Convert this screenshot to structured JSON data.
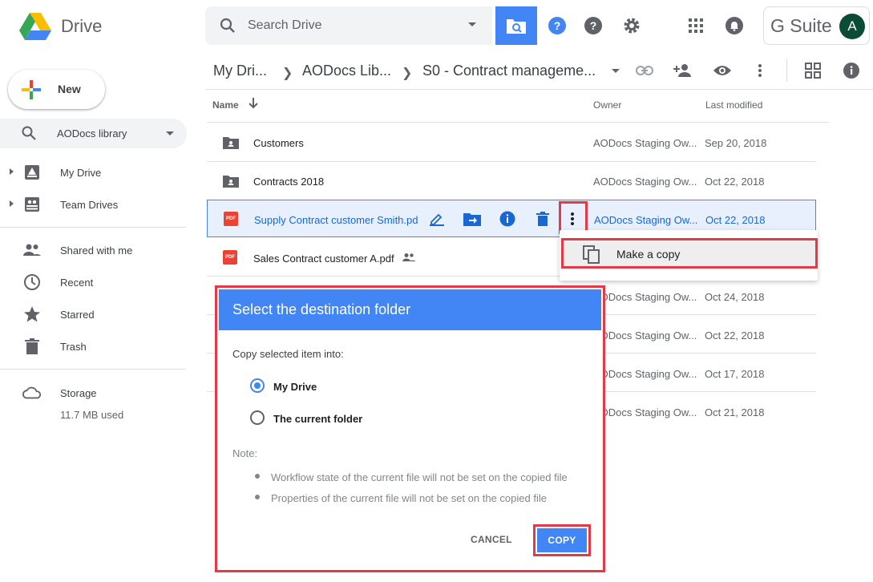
{
  "app": {
    "title": "Drive"
  },
  "search": {
    "placeholder": "Search Drive"
  },
  "header": {
    "suite_label": "G Suite",
    "avatar_letter": "A"
  },
  "sidebar": {
    "new_label": "New",
    "library_label": "AODocs library",
    "items": [
      {
        "label": "My Drive",
        "icon": "my-drive-icon"
      },
      {
        "label": "Team Drives",
        "icon": "team-drives-icon"
      },
      {
        "label": "Shared with me",
        "icon": "people-icon"
      },
      {
        "label": "Recent",
        "icon": "clock-icon"
      },
      {
        "label": "Starred",
        "icon": "star-icon"
      },
      {
        "label": "Trash",
        "icon": "trash-icon"
      },
      {
        "label": "Storage",
        "icon": "cloud-icon"
      }
    ],
    "storage_used": "11.7 MB used"
  },
  "breadcrumb": {
    "items": [
      "My Dri...",
      "AODocs Lib...",
      "S0 - Contract manageme..."
    ]
  },
  "list": {
    "columns": {
      "name": "Name",
      "owner": "Owner",
      "modified": "Last modified"
    },
    "rows": [
      {
        "name": "Customers",
        "owner": "AODocs Staging Ow...",
        "modified": "Sep 20, 2018",
        "type": "shared-folder"
      },
      {
        "name": "Contracts 2018",
        "owner": "AODocs Staging Ow...",
        "modified": "Oct 22, 2018",
        "type": "shared-folder"
      },
      {
        "name": "Supply Contract customer Smith.pd",
        "owner": "AODocs Staging Ow...",
        "modified": "Oct 22, 2018",
        "type": "pdf",
        "selected": true
      },
      {
        "name": "Sales Contract customer A.pdf",
        "owner": "",
        "modified": "",
        "type": "pdf"
      },
      {
        "name": "",
        "owner": "AODocs Staging Ow...",
        "modified": "Oct 24, 2018"
      },
      {
        "name": "",
        "owner": "AODocs Staging Ow...",
        "modified": "Oct 22, 2018"
      },
      {
        "name": "",
        "owner": "AODocs Staging Ow...",
        "modified": "Oct 17, 2018"
      },
      {
        "name": "",
        "owner": "AODocs Staging Ow...",
        "modified": "Oct 21, 2018"
      }
    ]
  },
  "context_menu": {
    "make_copy": "Make a copy"
  },
  "dialog": {
    "title": "Select the destination folder",
    "prompt": "Copy selected item into:",
    "options": [
      "My Drive",
      "The current folder"
    ],
    "selected_option": "My Drive",
    "note_label": "Note:",
    "notes": [
      "Workflow state of the current file will not be set on the copied file",
      "Properties of the current file will not be set on the copied file"
    ],
    "cancel_label": "CANCEL",
    "copy_label": "COPY"
  },
  "colors": {
    "accent": "#4285f4",
    "highlight": "#e53947",
    "selected_bg": "#e8f0fe",
    "pdf_red": "#ea4335"
  }
}
